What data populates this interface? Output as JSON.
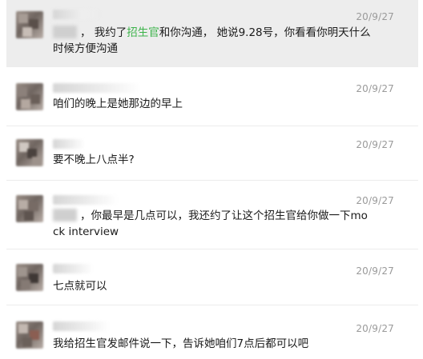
{
  "messages": [
    {
      "time": "20/9/27",
      "pre": "， 我约了",
      "keyword": "招生官",
      "post": "和你沟通， 她说9.28号，你看看你明天什么时候方便沟通"
    },
    {
      "time": "20/9/27",
      "text": "咱们的晚上是她那边的早上"
    },
    {
      "time": "20/9/27",
      "text": "要不晚上八点半?"
    },
    {
      "time": "20/9/27",
      "text": "，你最早是几点可以，我还约了让这个招生官给你做一下mock interview"
    },
    {
      "time": "20/9/27",
      "text": "七点就可以"
    },
    {
      "time": "20/9/27",
      "text": "我给招生官发邮件说一下，告诉她咱们7点后都可以吧"
    }
  ],
  "colors": {
    "highlight_bg": "#ededed",
    "keyword": "#3cb34a",
    "time": "#9a9a9a"
  }
}
